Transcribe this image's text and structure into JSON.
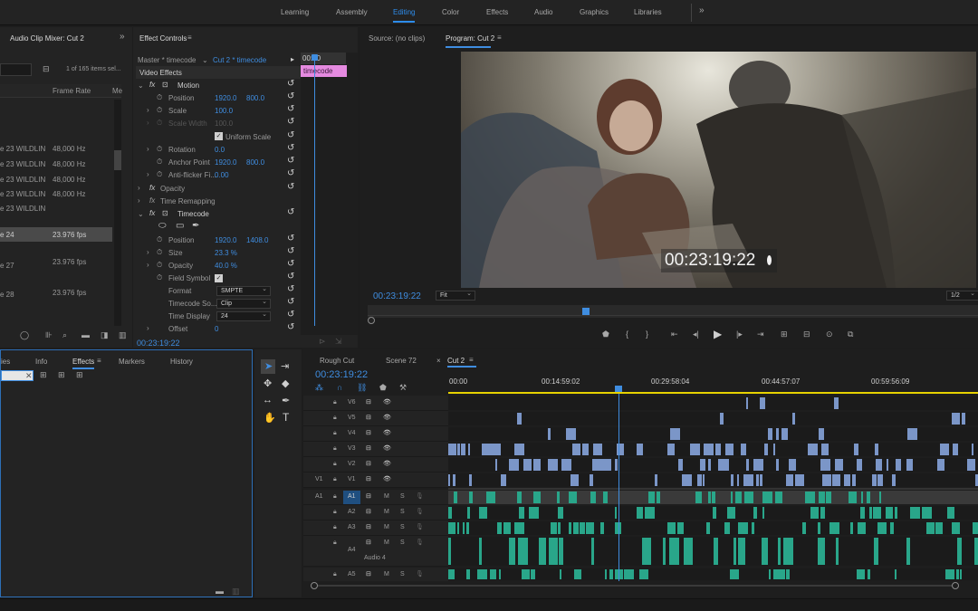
{
  "workspace_tabs": [
    "Learning",
    "Assembly",
    "Editing",
    "Color",
    "Effects",
    "Audio",
    "Graphics",
    "Libraries"
  ],
  "workspace_active": "Editing",
  "workspace_more": "»",
  "project_panel": {
    "tab": "Audio Clip Mixer: Cut 2",
    "more": "»",
    "items_count": "1 of 165 items sel...",
    "columns": [
      "Frame Rate",
      "Me"
    ],
    "rows": [
      {
        "name": "e 23 WILDLIN",
        "rate": "48,000 Hz"
      },
      {
        "name": "e 23 WILDLIN",
        "rate": "48,000 Hz"
      },
      {
        "name": "e 23 WILDLIN",
        "rate": "48,000 Hz"
      },
      {
        "name": "e 23 WILDLIN",
        "rate": "48,000 Hz"
      },
      {
        "name": "e 23 WILDLIN",
        "rate": ""
      },
      {
        "name": "e 24",
        "rate": "23.976 fps"
      },
      {
        "name": "e 27",
        "rate": "23.976 fps"
      },
      {
        "name": "e 28",
        "rate": "23.976 fps"
      }
    ]
  },
  "effect_controls": {
    "tab": "Effect Controls",
    "menu": "≡",
    "master": "Master * timecode",
    "clip": "Cut 2 * timecode",
    "mini_time": "00:00",
    "clip_label": "timecode",
    "video_effects": "Video Effects",
    "motion": "Motion",
    "position_label": "Position",
    "position_x": "1920.0",
    "position_y": "800.0",
    "scale_label": "Scale",
    "scale_value": "100.0",
    "scale_width_label": "Scale Width",
    "scale_width_value": "100.0",
    "uniform_scale": "Uniform Scale",
    "rotation_label": "Rotation",
    "rotation_value": "0.0",
    "anchor_label": "Anchor Point",
    "anchor_x": "1920.0",
    "anchor_y": "800.0",
    "flicker_label": "Anti-flicker Fi...",
    "flicker_value": "0.00",
    "opacity": "Opacity",
    "time_remap": "Time Remapping",
    "timecode": "Timecode",
    "tc_position_label": "Position",
    "tc_position_x": "1920.0",
    "tc_position_y": "1408.0",
    "tc_size_label": "Size",
    "tc_size_value": "23.3 %",
    "tc_opacity_label": "Opacity",
    "tc_opacity_value": "40.0 %",
    "field_symbol": "Field Symbol",
    "format_label": "Format",
    "format_value": "SMPTE",
    "tc_source_label": "Timecode So...",
    "tc_source_value": "Clip",
    "time_display_label": "Time Display",
    "time_display_value": "24",
    "offset_label": "Offset",
    "offset_value": "0",
    "current_time": "00:23:19:22"
  },
  "monitor": {
    "source_tab": "Source: (no clips)",
    "program_tab": "Program: Cut 2",
    "menu": "≡",
    "overlay_timecode": "00:23:19:22",
    "timecode": "00:23:19:22",
    "fit": "Fit",
    "quality": "1/2"
  },
  "effects_panel": {
    "tabs": [
      "ies",
      "Info",
      "Effects",
      "Markers",
      "History"
    ],
    "active": "Effects",
    "menu": "≡"
  },
  "timeline": {
    "tabs": [
      "Rough Cut",
      "Scene 72",
      "Cut 2"
    ],
    "close": "×",
    "menu": "≡",
    "timecode": "00:23:19:22",
    "ruler": [
      "00:00",
      "00:14:59:02",
      "00:29:58:04",
      "00:44:57:07",
      "00:59:56:09"
    ],
    "video_tracks": [
      "V6",
      "V5",
      "V4",
      "V3",
      "V2",
      "V1"
    ],
    "source_v": "V1",
    "audio_tracks": [
      "A1",
      "A2",
      "A3",
      "A4",
      "A5"
    ],
    "source_a": "A1",
    "audio4_name": "Audio 4",
    "m": "M",
    "s": "S"
  },
  "colors": {
    "accent": "#2d8ceb",
    "video_clip": "#7b96c8",
    "audio_clip": "#29a68a",
    "label_pink": "#e58ae0"
  }
}
